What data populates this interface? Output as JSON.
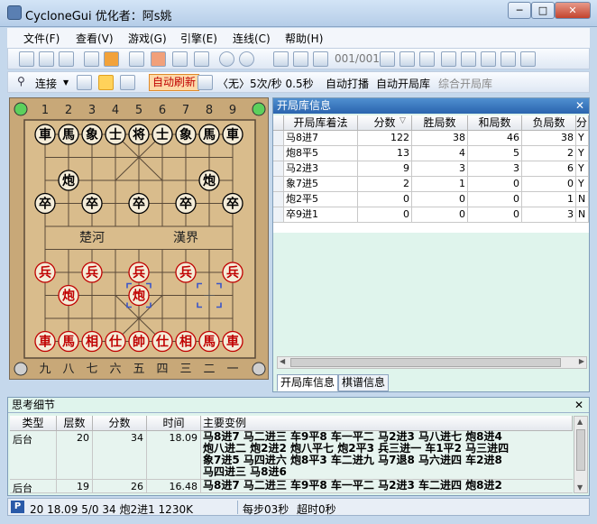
{
  "window": {
    "title": "CycloneGui 优化者：阿s姚",
    "min": "─",
    "max": "□",
    "close": "✕"
  },
  "menu": [
    "文件(F)",
    "查看(V)",
    "游戏(G)",
    "引擎(E)",
    "连线(C)",
    "帮助(H)"
  ],
  "toolbar1": {
    "page": "001/001"
  },
  "toolbar2": {
    "connect": "连接",
    "refresh": "自动刷新",
    "mode": "〈无〉5次/秒 0.5秒",
    "auto_play": "自动打播",
    "auto_book": "自动开局库",
    "merge_book": "综合开局库"
  },
  "board": {
    "top_labels": [
      "1",
      "2",
      "3",
      "4",
      "5",
      "6",
      "7",
      "8",
      "9"
    ],
    "bottom_labels": [
      "九",
      "八",
      "七",
      "六",
      "五",
      "四",
      "三",
      "二",
      "一"
    ],
    "river_left": "楚河",
    "river_right": "漢界",
    "black_pieces": [
      [
        "車",
        0,
        0
      ],
      [
        "馬",
        1,
        0
      ],
      [
        "象",
        2,
        0
      ],
      [
        "士",
        3,
        0
      ],
      [
        "将",
        4,
        0
      ],
      [
        "士",
        5,
        0
      ],
      [
        "象",
        6,
        0
      ],
      [
        "馬",
        7,
        0
      ],
      [
        "車",
        8,
        0
      ],
      [
        "炮",
        1,
        2
      ],
      [
        "炮",
        7,
        2
      ],
      [
        "卒",
        0,
        3
      ],
      [
        "卒",
        2,
        3
      ],
      [
        "卒",
        4,
        3
      ],
      [
        "卒",
        6,
        3
      ],
      [
        "卒",
        8,
        3
      ]
    ],
    "red_pieces": [
      [
        "兵",
        0,
        6
      ],
      [
        "兵",
        2,
        6
      ],
      [
        "兵",
        4,
        6
      ],
      [
        "兵",
        6,
        6
      ],
      [
        "兵",
        8,
        6
      ],
      [
        "炮",
        1,
        7
      ],
      [
        "炮",
        4,
        7
      ],
      [
        "車",
        0,
        9
      ],
      [
        "馬",
        1,
        9
      ],
      [
        "相",
        2,
        9
      ],
      [
        "仕",
        3,
        9
      ],
      [
        "帥",
        4,
        9
      ],
      [
        "仕",
        5,
        9
      ],
      [
        "相",
        6,
        9
      ],
      [
        "馬",
        7,
        9
      ],
      [
        "車",
        8,
        9
      ]
    ],
    "colors": {
      "board": "#d9bc8c",
      "line": "#5a4a38",
      "red": "#c00000",
      "black": "#000000",
      "piece": "#f4ecd8",
      "select": "#3a55c8"
    }
  },
  "book_panel": {
    "title": "开局库信息",
    "headers": [
      "开局库着法",
      "分数",
      "胜局数",
      "和局数",
      "负局数",
      "分"
    ],
    "rows": [
      [
        "马8进7",
        "122",
        "38",
        "46",
        "38",
        "Y"
      ],
      [
        "炮8平5",
        "13",
        "4",
        "5",
        "2",
        "Y"
      ],
      [
        "马2进3",
        "9",
        "3",
        "3",
        "6",
        "Y"
      ],
      [
        "象7进5",
        "2",
        "1",
        "0",
        "0",
        "Y"
      ],
      [
        "炮2平5",
        "0",
        "0",
        "0",
        "1",
        "N"
      ],
      [
        "卒9进1",
        "0",
        "0",
        "0",
        "3",
        "N"
      ]
    ],
    "tabs": [
      "开局库信息",
      "棋谱信息"
    ]
  },
  "think_panel": {
    "title": "思考细节",
    "headers": [
      "类型",
      "层数",
      "分数",
      "时间",
      "主要变例"
    ],
    "rows": [
      {
        "type": "后台",
        "depth": "20",
        "score": "34",
        "time": "18.09",
        "pv": [
          "马8进7 马二进三 车9平8 车一平二 马2进3 马八进七 炮8进4",
          "炮八进二 炮2进2 炮八平七 炮2平3 兵三进一 车1平2 马三进四",
          "象7进5 马四进六 炮8平3 车二进九 马7退8 马六进四 车2进8",
          "马四进三 马8进6"
        ]
      },
      {
        "type": "后台",
        "depth": "19",
        "score": "26",
        "time": "16.48",
        "pv": [
          "马8进7 马二进三 车9平8 车一平二 马2进3 车二进四 炮8进2"
        ]
      }
    ]
  },
  "status": {
    "badge": "P",
    "info": "20 18.09 5/0 34 炮2进1 1230K",
    "speed": "每步03秒",
    "timeout": "超时0秒"
  }
}
